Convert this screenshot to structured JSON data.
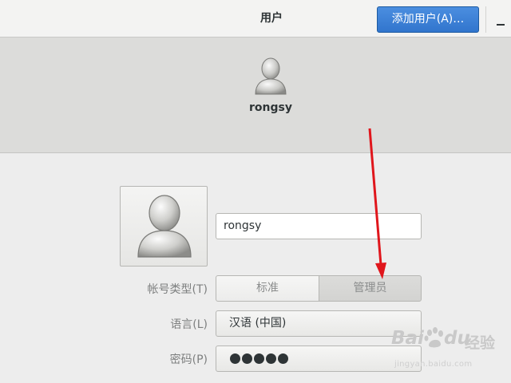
{
  "header": {
    "title": "用户",
    "add_user_label": "添加用户(A)…"
  },
  "user_strip": {
    "username": "rongsy"
  },
  "details": {
    "name_value": "rongsy",
    "account_type_label": "帐号类型(T)",
    "account_type_options": [
      "标准",
      "管理员"
    ],
    "account_type_selected": "管理员",
    "language_label": "语言(L)",
    "language_value": "汉语 (中国)",
    "password_label": "密码(P)",
    "password_mask_count": 5
  },
  "watermark": {
    "brand": "Baidu",
    "brand_cn": "经验",
    "url": "jingyan.baidu.com"
  },
  "annotation": {
    "arrow_color": "#e0161c"
  },
  "colors": {
    "accent": "#3a7fd6",
    "header_bg": "#f3f3f2",
    "strip_bg": "#dcdcda",
    "body_bg": "#ededed"
  }
}
